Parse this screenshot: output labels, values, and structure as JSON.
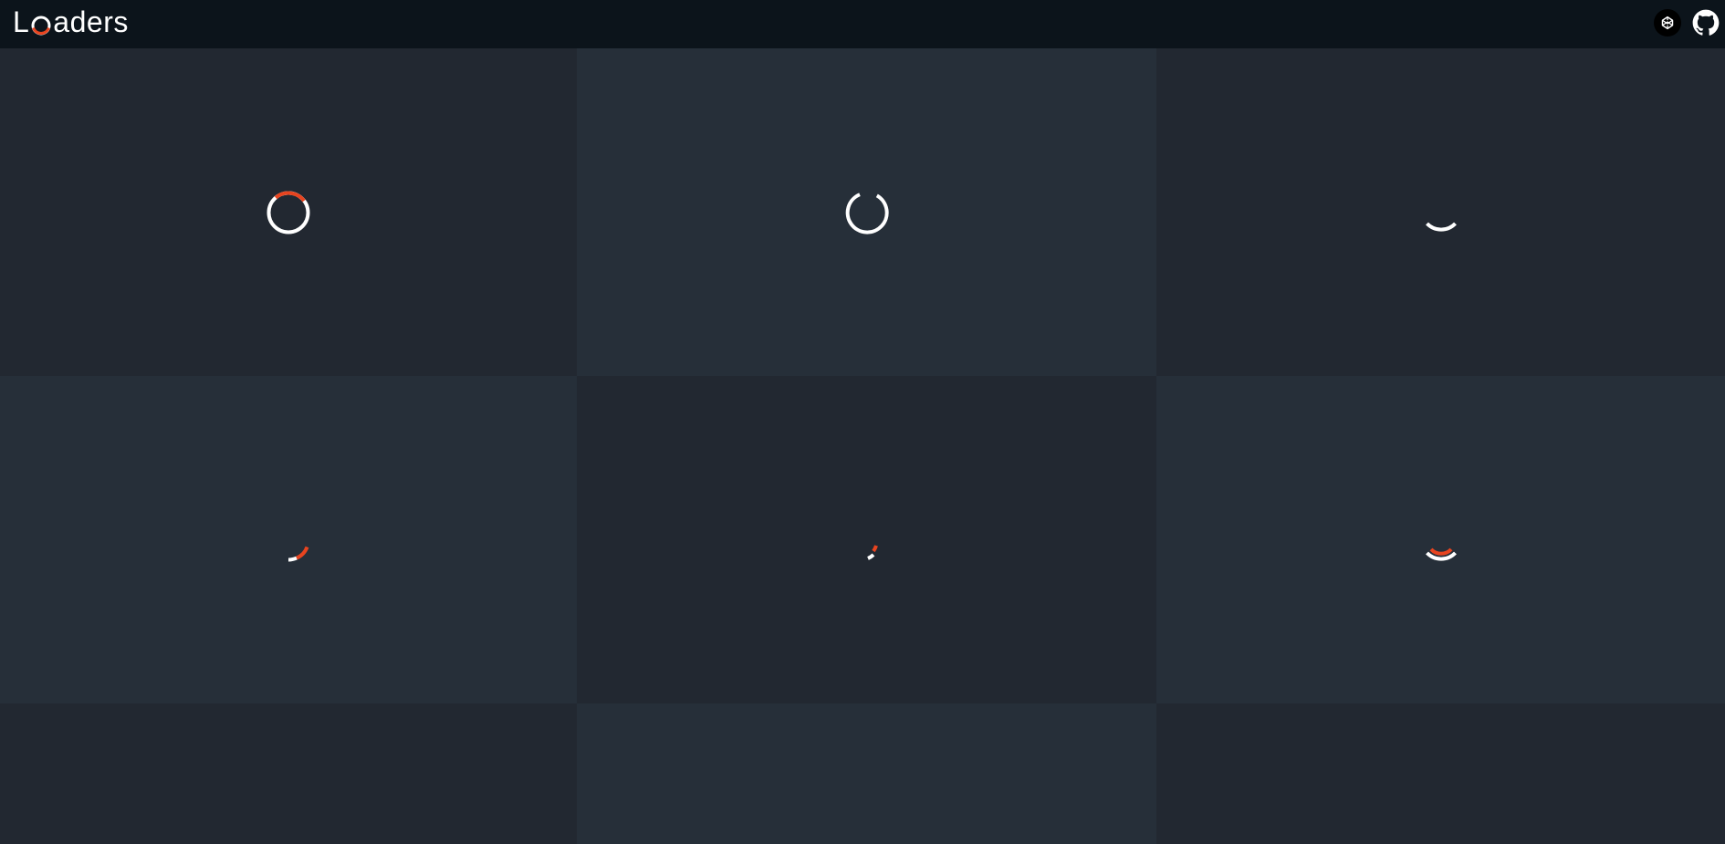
{
  "header": {
    "title_prefix": "L",
    "title_suffix": "aders",
    "logo_accent": "#e8441f",
    "icons": [
      "codepen-icon",
      "github-icon"
    ]
  },
  "colors": {
    "header_bg": "#0c141b",
    "cell_dark": "#222831",
    "cell_light": "#262f39",
    "spinner_white": "#ffffff",
    "spinner_accent": "#e8441f"
  },
  "loaders": [
    {
      "id": 1,
      "style": "full-ring-with-accent-arc"
    },
    {
      "id": 2,
      "style": "open-ring"
    },
    {
      "id": 3,
      "style": "bottom-arc"
    },
    {
      "id": 4,
      "style": "corner-arc-with-accent"
    },
    {
      "id": 5,
      "style": "small-arc-with-accent"
    },
    {
      "id": 6,
      "style": "bottom-arc-with-accent"
    },
    {
      "id": 7,
      "style": "empty"
    },
    {
      "id": 8,
      "style": "empty"
    },
    {
      "id": 9,
      "style": "empty"
    }
  ]
}
